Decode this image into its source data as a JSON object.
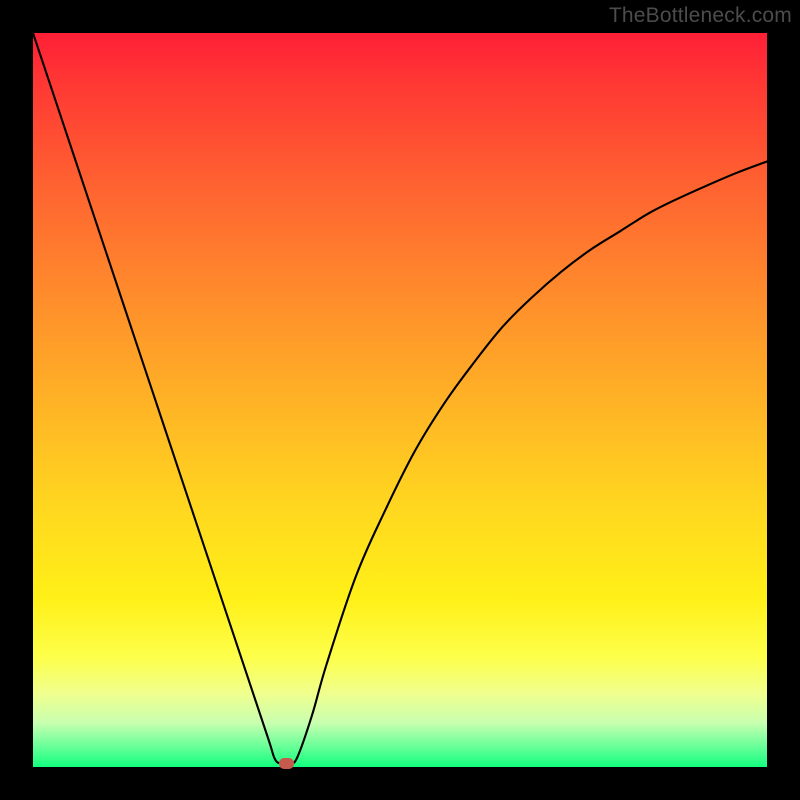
{
  "watermark": "TheBottleneck.com",
  "chart_data": {
    "type": "line",
    "title": "",
    "xlabel": "",
    "ylabel": "",
    "xlim": [
      0,
      100
    ],
    "ylim": [
      0,
      100
    ],
    "grid": false,
    "series": [
      {
        "name": "bottleneck-curve",
        "x": [
          0,
          4,
          8,
          12,
          16,
          20,
          24,
          28,
          32,
          33,
          34,
          35,
          36,
          38,
          40,
          44,
          48,
          52,
          56,
          60,
          64,
          68,
          72,
          76,
          80,
          84,
          88,
          92,
          96,
          100
        ],
        "y": [
          100,
          88,
          76,
          64,
          52,
          40,
          28,
          16,
          4,
          1,
          0.5,
          0.5,
          1.3,
          7,
          14,
          26,
          35,
          43,
          49.5,
          55,
          60,
          64,
          67.5,
          70.5,
          73,
          75.5,
          77.5,
          79.3,
          81,
          82.5
        ]
      }
    ],
    "gradient_stops": [
      {
        "pos": 0,
        "color": "#ff1f36"
      },
      {
        "pos": 7,
        "color": "#ff3834"
      },
      {
        "pos": 20,
        "color": "#ff6031"
      },
      {
        "pos": 35,
        "color": "#ff8a2c"
      },
      {
        "pos": 50,
        "color": "#ffb226"
      },
      {
        "pos": 65,
        "color": "#ffd81f"
      },
      {
        "pos": 77,
        "color": "#fff018"
      },
      {
        "pos": 85,
        "color": "#fdff4a"
      },
      {
        "pos": 90,
        "color": "#f0ff8e"
      },
      {
        "pos": 94,
        "color": "#c8ffb0"
      },
      {
        "pos": 97,
        "color": "#6eff9a"
      },
      {
        "pos": 100,
        "color": "#12ff7e"
      }
    ],
    "marker": {
      "x": 34.6,
      "y": 0.5,
      "color": "#c65a4c"
    }
  }
}
